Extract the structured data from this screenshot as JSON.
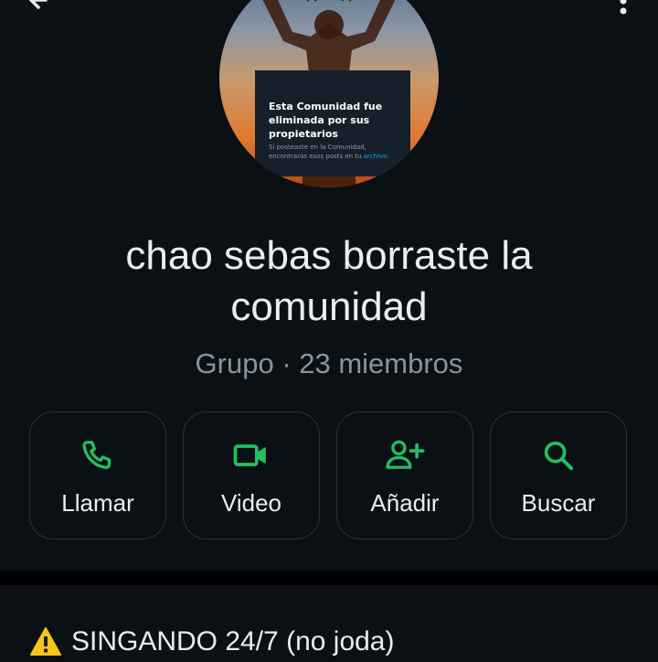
{
  "avatar": {
    "card_title": "Esta Comunidad fue eliminada por sus propietarios",
    "card_text": "Si posteaste en la Comunidad, encontrarás esos posts en tu",
    "card_link": "archivo."
  },
  "group": {
    "name": "chao sebas borraste la comunidad",
    "meta": "Grupo · 23 miembros"
  },
  "actions": [
    {
      "label": "Llamar",
      "icon": "phone-icon"
    },
    {
      "label": "Video",
      "icon": "video-icon"
    },
    {
      "label": "Añadir",
      "icon": "add-person-icon"
    },
    {
      "label": "Buscar",
      "icon": "search-icon"
    }
  ],
  "description": {
    "icon": "warning-icon",
    "text": "SINGANDO 24/7 (no joda)"
  },
  "colors": {
    "background": "#0b1014",
    "accent": "#21c063",
    "secondary_text": "#8696a0",
    "warning": "#f5c518"
  }
}
